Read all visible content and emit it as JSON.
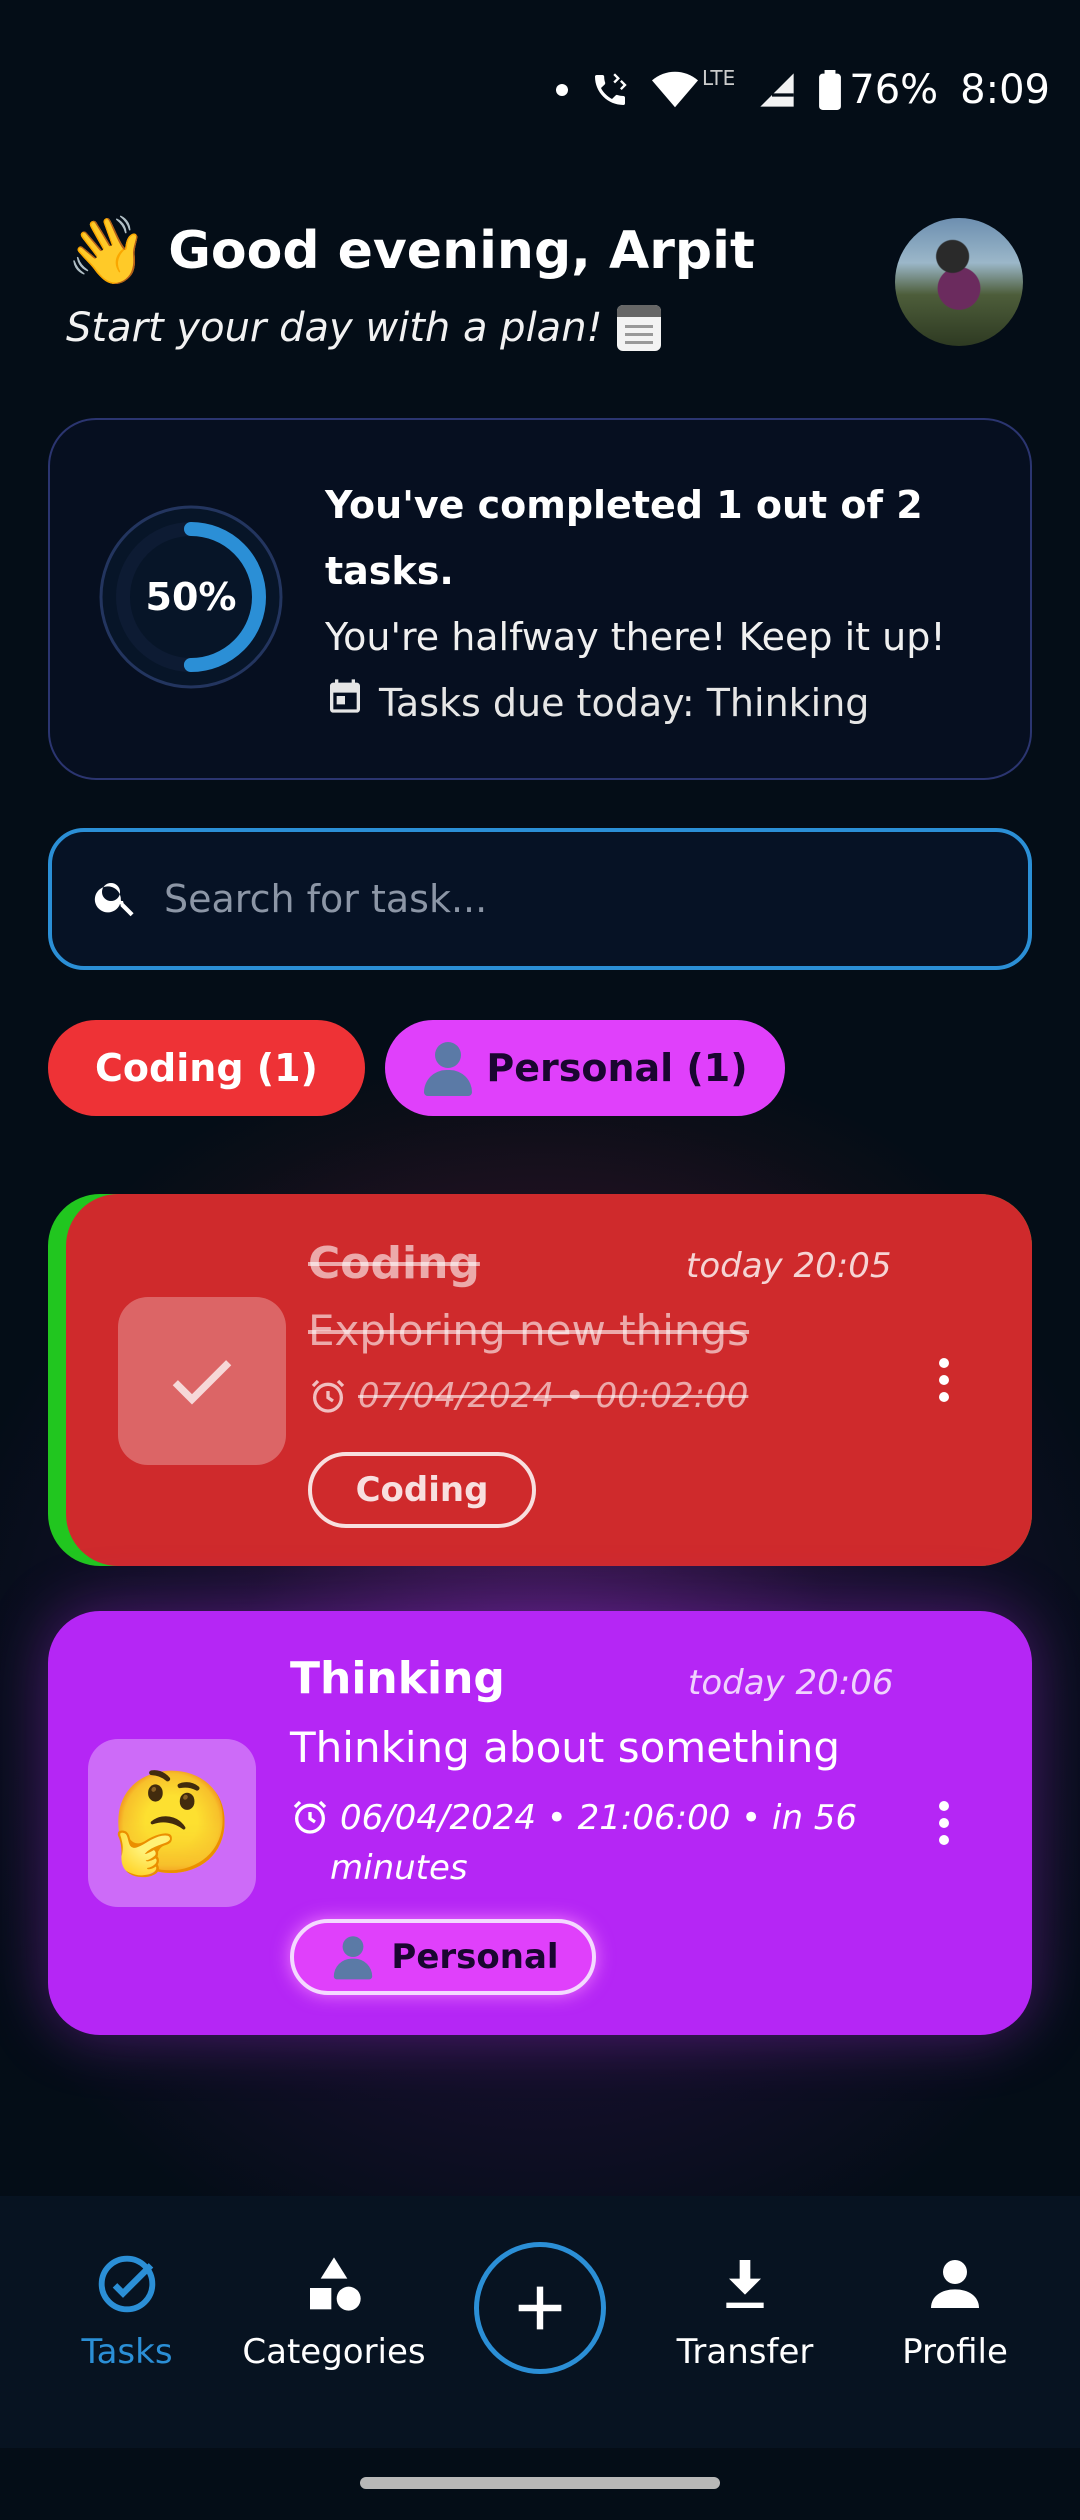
{
  "status_bar": {
    "network": "LTE",
    "battery": "76%",
    "time": "8:09"
  },
  "header": {
    "wave_emoji": "👋",
    "greeting": "Good evening, Arpit",
    "subtitle": "Start your day with a plan!"
  },
  "progress": {
    "percent_label": "50%",
    "percent_value": 50,
    "headline": "You've completed 1 out of 2 tasks.",
    "message": "You're halfway there! Keep it up!",
    "due_today": "Tasks due today: Thinking"
  },
  "search": {
    "placeholder": "Search for task..."
  },
  "categories": [
    {
      "label": "Coding (1)",
      "color": "#ee3236"
    },
    {
      "label": "Personal (1)",
      "color": "#e040fb"
    }
  ],
  "tasks": [
    {
      "title": "Coding",
      "time": "today 20:05",
      "description": "Exploring new things",
      "deadline": "07/04/2024 • 00:02:00",
      "category": "Coding",
      "completed": true,
      "color": "#cf2a2c",
      "accent": "#21c61f"
    },
    {
      "title": "Thinking",
      "time": "today 20:06",
      "description": "Thinking about something",
      "deadline": "06/04/2024 • 21:06:00 • in 56",
      "deadline_cont": "minutes",
      "category": "Personal",
      "emoji": "🤔",
      "completed": false,
      "color": "#b526f5"
    }
  ],
  "nav": {
    "tasks": "Tasks",
    "categories": "Categories",
    "transfer": "Transfer",
    "profile": "Profile",
    "active_color": "#2b8fd6"
  }
}
